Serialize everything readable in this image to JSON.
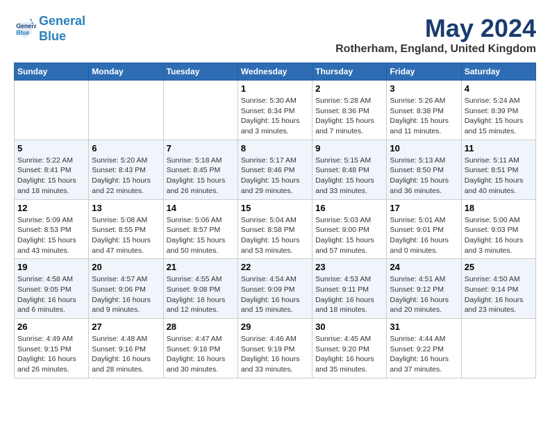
{
  "header": {
    "logo_line1": "General",
    "logo_line2": "Blue",
    "month": "May 2024",
    "location": "Rotherham, England, United Kingdom"
  },
  "weekdays": [
    "Sunday",
    "Monday",
    "Tuesday",
    "Wednesday",
    "Thursday",
    "Friday",
    "Saturday"
  ],
  "weeks": [
    [
      {
        "day": "",
        "info": ""
      },
      {
        "day": "",
        "info": ""
      },
      {
        "day": "",
        "info": ""
      },
      {
        "day": "1",
        "info": "Sunrise: 5:30 AM\nSunset: 8:34 PM\nDaylight: 15 hours\nand 3 minutes."
      },
      {
        "day": "2",
        "info": "Sunrise: 5:28 AM\nSunset: 8:36 PM\nDaylight: 15 hours\nand 7 minutes."
      },
      {
        "day": "3",
        "info": "Sunrise: 5:26 AM\nSunset: 8:38 PM\nDaylight: 15 hours\nand 11 minutes."
      },
      {
        "day": "4",
        "info": "Sunrise: 5:24 AM\nSunset: 8:39 PM\nDaylight: 15 hours\nand 15 minutes."
      }
    ],
    [
      {
        "day": "5",
        "info": "Sunrise: 5:22 AM\nSunset: 8:41 PM\nDaylight: 15 hours\nand 18 minutes."
      },
      {
        "day": "6",
        "info": "Sunrise: 5:20 AM\nSunset: 8:43 PM\nDaylight: 15 hours\nand 22 minutes."
      },
      {
        "day": "7",
        "info": "Sunrise: 5:18 AM\nSunset: 8:45 PM\nDaylight: 15 hours\nand 26 minutes."
      },
      {
        "day": "8",
        "info": "Sunrise: 5:17 AM\nSunset: 8:46 PM\nDaylight: 15 hours\nand 29 minutes."
      },
      {
        "day": "9",
        "info": "Sunrise: 5:15 AM\nSunset: 8:48 PM\nDaylight: 15 hours\nand 33 minutes."
      },
      {
        "day": "10",
        "info": "Sunrise: 5:13 AM\nSunset: 8:50 PM\nDaylight: 15 hours\nand 36 minutes."
      },
      {
        "day": "11",
        "info": "Sunrise: 5:11 AM\nSunset: 8:51 PM\nDaylight: 15 hours\nand 40 minutes."
      }
    ],
    [
      {
        "day": "12",
        "info": "Sunrise: 5:09 AM\nSunset: 8:53 PM\nDaylight: 15 hours\nand 43 minutes."
      },
      {
        "day": "13",
        "info": "Sunrise: 5:08 AM\nSunset: 8:55 PM\nDaylight: 15 hours\nand 47 minutes."
      },
      {
        "day": "14",
        "info": "Sunrise: 5:06 AM\nSunset: 8:57 PM\nDaylight: 15 hours\nand 50 minutes."
      },
      {
        "day": "15",
        "info": "Sunrise: 5:04 AM\nSunset: 8:58 PM\nDaylight: 15 hours\nand 53 minutes."
      },
      {
        "day": "16",
        "info": "Sunrise: 5:03 AM\nSunset: 9:00 PM\nDaylight: 15 hours\nand 57 minutes."
      },
      {
        "day": "17",
        "info": "Sunrise: 5:01 AM\nSunset: 9:01 PM\nDaylight: 16 hours\nand 0 minutes."
      },
      {
        "day": "18",
        "info": "Sunrise: 5:00 AM\nSunset: 9:03 PM\nDaylight: 16 hours\nand 3 minutes."
      }
    ],
    [
      {
        "day": "19",
        "info": "Sunrise: 4:58 AM\nSunset: 9:05 PM\nDaylight: 16 hours\nand 6 minutes."
      },
      {
        "day": "20",
        "info": "Sunrise: 4:57 AM\nSunset: 9:06 PM\nDaylight: 16 hours\nand 9 minutes."
      },
      {
        "day": "21",
        "info": "Sunrise: 4:55 AM\nSunset: 9:08 PM\nDaylight: 16 hours\nand 12 minutes."
      },
      {
        "day": "22",
        "info": "Sunrise: 4:54 AM\nSunset: 9:09 PM\nDaylight: 16 hours\nand 15 minutes."
      },
      {
        "day": "23",
        "info": "Sunrise: 4:53 AM\nSunset: 9:11 PM\nDaylight: 16 hours\nand 18 minutes."
      },
      {
        "day": "24",
        "info": "Sunrise: 4:51 AM\nSunset: 9:12 PM\nDaylight: 16 hours\nand 20 minutes."
      },
      {
        "day": "25",
        "info": "Sunrise: 4:50 AM\nSunset: 9:14 PM\nDaylight: 16 hours\nand 23 minutes."
      }
    ],
    [
      {
        "day": "26",
        "info": "Sunrise: 4:49 AM\nSunset: 9:15 PM\nDaylight: 16 hours\nand 26 minutes."
      },
      {
        "day": "27",
        "info": "Sunrise: 4:48 AM\nSunset: 9:16 PM\nDaylight: 16 hours\nand 28 minutes."
      },
      {
        "day": "28",
        "info": "Sunrise: 4:47 AM\nSunset: 9:18 PM\nDaylight: 16 hours\nand 30 minutes."
      },
      {
        "day": "29",
        "info": "Sunrise: 4:46 AM\nSunset: 9:19 PM\nDaylight: 16 hours\nand 33 minutes."
      },
      {
        "day": "30",
        "info": "Sunrise: 4:45 AM\nSunset: 9:20 PM\nDaylight: 16 hours\nand 35 minutes."
      },
      {
        "day": "31",
        "info": "Sunrise: 4:44 AM\nSunset: 9:22 PM\nDaylight: 16 hours\nand 37 minutes."
      },
      {
        "day": "",
        "info": ""
      }
    ]
  ]
}
